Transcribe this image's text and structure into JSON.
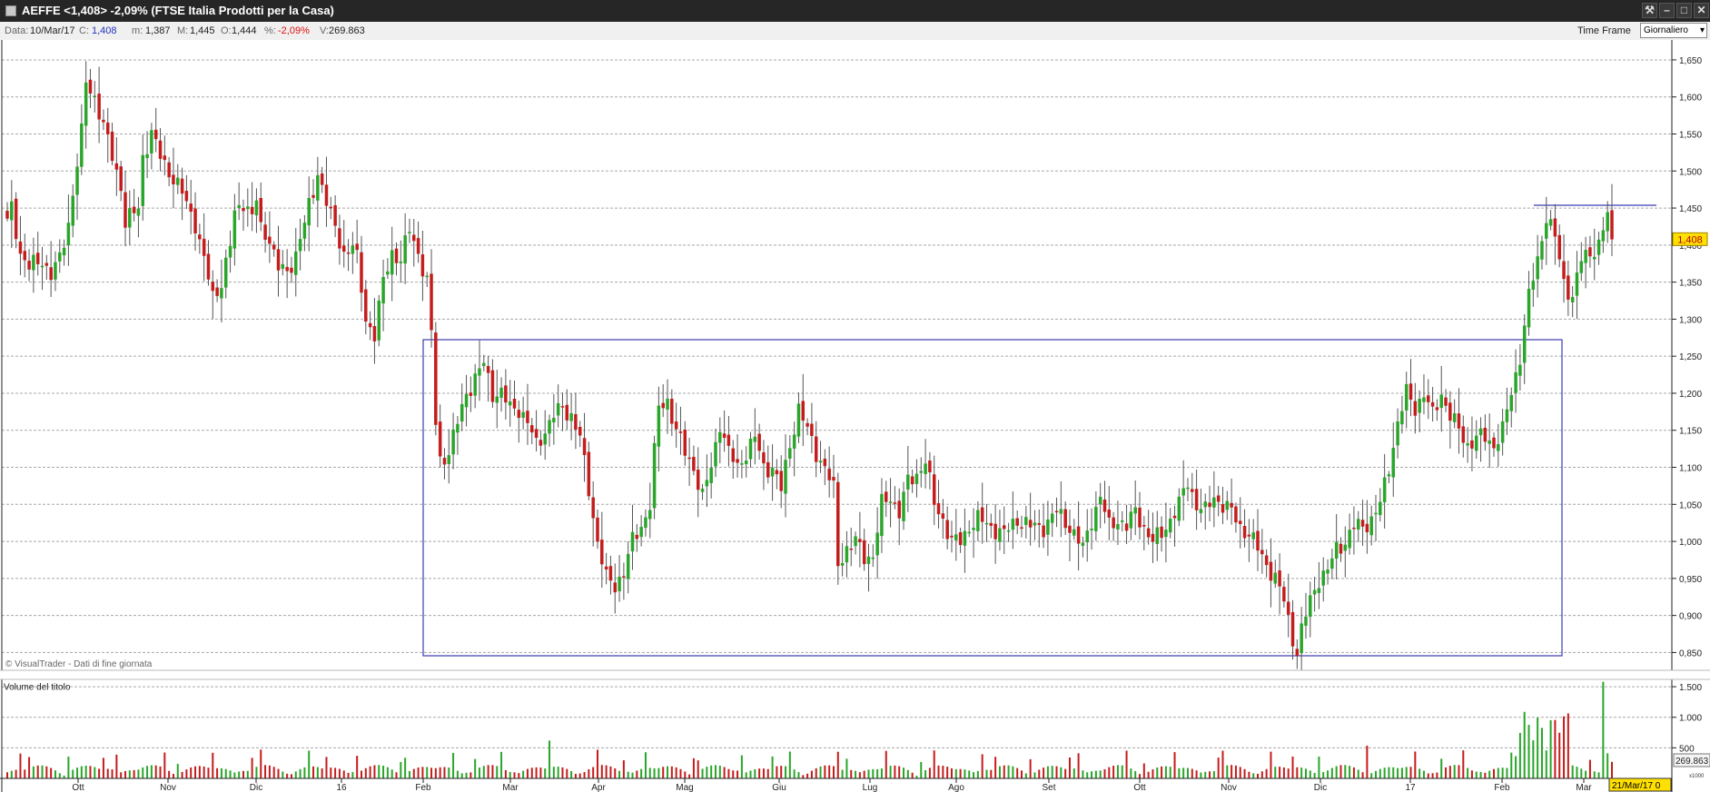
{
  "window": {
    "title": "AEFFE <1,408> -2,09%  (FTSE Italia Prodotti per la Casa)"
  },
  "infobar": {
    "date_label": "Data:",
    "date_value": "10/Mar/17",
    "close_label": "C:",
    "close_value": "1,408",
    "min_label": "m:",
    "min_value": "1,387",
    "max_label": "M:",
    "max_value": "1,445",
    "open_label": "O:",
    "open_value": "1,444",
    "pct_label": "%:",
    "pct_value": "-2,09%",
    "vol_label": "V:",
    "vol_value": "269.863",
    "timeframe_label": "Time Frame",
    "timeframe_value": "Giornaliero"
  },
  "chart_data": {
    "type": "candlestick",
    "price_axis": {
      "ticks": [
        "1,650",
        "1,600",
        "1,550",
        "1,500",
        "1,450",
        "1,400",
        "1,350",
        "1,300",
        "1,250",
        "1,200",
        "1,150",
        "1,100",
        "1,050",
        "1,000",
        "0,950",
        "0,900",
        "0,850"
      ],
      "range": [
        0.826,
        1.672
      ]
    },
    "last_price_label": "1,408",
    "last_price": 1.408,
    "watermark": "© VisualTrader - Dati di fine giornata",
    "volume_title": "Volume del titolo",
    "volume_axis": {
      "ticks": [
        "1.500",
        "1.000",
        "500"
      ],
      "range": [
        0,
        1620
      ],
      "unit_label": "x1000"
    },
    "last_volume_label": "269.863",
    "x_axis_labels": [
      "Ott",
      "Nov",
      "Dic",
      "16",
      "Feb",
      "Mar",
      "Apr",
      "Mag",
      "Giu",
      "Lug",
      "Ago",
      "Set",
      "Ott",
      "Nov",
      "Dic",
      "17",
      "Feb",
      "Mar"
    ],
    "cursor_date_label": "21/Mar/17 0",
    "anchors": [
      [
        0,
        1.43
      ],
      [
        1,
        1.45
      ],
      [
        3,
        1.39
      ],
      [
        5,
        1.37
      ],
      [
        8,
        1.38
      ],
      [
        10,
        1.36
      ],
      [
        12,
        1.38
      ],
      [
        14,
        1.43
      ],
      [
        17,
        1.55
      ],
      [
        18,
        1.62
      ],
      [
        20,
        1.6
      ],
      [
        22,
        1.56
      ],
      [
        24,
        1.52
      ],
      [
        26,
        1.48
      ],
      [
        27,
        1.43
      ],
      [
        30,
        1.45
      ],
      [
        31,
        1.52
      ],
      [
        33,
        1.55
      ],
      [
        35,
        1.52
      ],
      [
        37,
        1.5
      ],
      [
        40,
        1.47
      ],
      [
        43,
        1.43
      ],
      [
        45,
        1.38
      ],
      [
        47,
        1.33
      ],
      [
        49,
        1.35
      ],
      [
        51,
        1.4
      ],
      [
        52,
        1.44
      ],
      [
        54,
        1.46
      ],
      [
        56,
        1.44
      ],
      [
        57,
        1.46
      ],
      [
        58,
        1.42
      ],
      [
        60,
        1.41
      ],
      [
        62,
        1.37
      ],
      [
        64,
        1.36
      ],
      [
        66,
        1.39
      ],
      [
        68,
        1.43
      ],
      [
        70,
        1.47
      ],
      [
        71,
        1.5
      ],
      [
        73,
        1.46
      ],
      [
        75,
        1.42
      ],
      [
        77,
        1.39
      ],
      [
        79,
        1.4
      ],
      [
        80,
        1.38
      ],
      [
        82,
        1.3
      ],
      [
        84,
        1.28
      ],
      [
        86,
        1.35
      ],
      [
        88,
        1.39
      ],
      [
        90,
        1.38
      ],
      [
        92,
        1.42
      ],
      [
        94,
        1.39
      ],
      [
        96,
        1.35
      ],
      [
        97,
        1.28
      ],
      [
        98,
        1.16
      ],
      [
        99,
        1.11
      ],
      [
        101,
        1.12
      ],
      [
        103,
        1.16
      ],
      [
        105,
        1.2
      ],
      [
        107,
        1.22
      ],
      [
        109,
        1.24
      ],
      [
        111,
        1.2
      ],
      [
        113,
        1.2
      ],
      [
        115,
        1.18
      ],
      [
        117,
        1.18
      ],
      [
        119,
        1.16
      ],
      [
        121,
        1.13
      ],
      [
        123,
        1.15
      ],
      [
        125,
        1.17
      ],
      [
        127,
        1.18
      ],
      [
        129,
        1.17
      ],
      [
        131,
        1.14
      ],
      [
        133,
        1.07
      ],
      [
        135,
        1.0
      ],
      [
        137,
        0.95
      ],
      [
        139,
        0.94
      ],
      [
        141,
        0.96
      ],
      [
        143,
        1.0
      ],
      [
        145,
        1.02
      ],
      [
        147,
        1.05
      ],
      [
        148,
        1.12
      ],
      [
        149,
        1.18
      ],
      [
        151,
        1.19
      ],
      [
        153,
        1.15
      ],
      [
        155,
        1.12
      ],
      [
        157,
        1.1
      ],
      [
        159,
        1.06
      ],
      [
        161,
        1.1
      ],
      [
        163,
        1.16
      ],
      [
        165,
        1.12
      ],
      [
        167,
        1.1
      ],
      [
        169,
        1.12
      ],
      [
        171,
        1.14
      ],
      [
        173,
        1.1
      ],
      [
        175,
        1.1
      ],
      [
        177,
        1.07
      ],
      [
        179,
        1.13
      ],
      [
        181,
        1.18
      ],
      [
        183,
        1.15
      ],
      [
        185,
        1.12
      ],
      [
        187,
        1.1
      ],
      [
        189,
        1.07
      ],
      [
        190,
        0.97
      ],
      [
        192,
        0.99
      ],
      [
        194,
        1.0
      ],
      [
        196,
        0.98
      ],
      [
        198,
        0.98
      ],
      [
        200,
        1.05
      ],
      [
        202,
        1.06
      ],
      [
        204,
        1.04
      ],
      [
        206,
        1.08
      ],
      [
        208,
        1.09
      ],
      [
        210,
        1.11
      ],
      [
        212,
        1.05
      ],
      [
        214,
        1.03
      ],
      [
        216,
        1.0
      ],
      [
        218,
        1.0
      ],
      [
        220,
        1.02
      ],
      [
        222,
        1.03
      ],
      [
        225,
        1.02
      ],
      [
        228,
        1.01
      ],
      [
        231,
        1.03
      ],
      [
        234,
        1.02
      ],
      [
        237,
        1.02
      ],
      [
        240,
        1.04
      ],
      [
        243,
        1.02
      ],
      [
        246,
        0.99
      ],
      [
        248,
        1.03
      ],
      [
        250,
        1.06
      ],
      [
        252,
        1.02
      ],
      [
        254,
        1.03
      ],
      [
        256,
        1.02
      ],
      [
        258,
        1.04
      ],
      [
        260,
        1.02
      ],
      [
        262,
        1.0
      ],
      [
        264,
        1.01
      ],
      [
        266,
        1.03
      ],
      [
        268,
        1.05
      ],
      [
        270,
        1.08
      ],
      [
        272,
        1.05
      ],
      [
        274,
        1.04
      ],
      [
        276,
        1.06
      ],
      [
        278,
        1.05
      ],
      [
        280,
        1.04
      ],
      [
        282,
        1.02
      ],
      [
        284,
        1.01
      ],
      [
        286,
        0.99
      ],
      [
        288,
        0.97
      ],
      [
        290,
        0.95
      ],
      [
        292,
        0.92
      ],
      [
        294,
        0.87
      ],
      [
        295,
        0.85
      ],
      [
        296,
        0.88
      ],
      [
        298,
        0.92
      ],
      [
        300,
        0.95
      ],
      [
        302,
        0.96
      ],
      [
        304,
        0.99
      ],
      [
        306,
        1.0
      ],
      [
        308,
        1.02
      ],
      [
        310,
        1.02
      ],
      [
        312,
        1.03
      ],
      [
        314,
        1.05
      ],
      [
        316,
        1.1
      ],
      [
        318,
        1.16
      ],
      [
        320,
        1.2
      ],
      [
        322,
        1.18
      ],
      [
        324,
        1.2
      ],
      [
        326,
        1.17
      ],
      [
        328,
        1.2
      ],
      [
        330,
        1.17
      ],
      [
        332,
        1.15
      ],
      [
        334,
        1.13
      ],
      [
        336,
        1.14
      ],
      [
        338,
        1.14
      ],
      [
        340,
        1.13
      ],
      [
        342,
        1.15
      ],
      [
        344,
        1.2
      ],
      [
        346,
        1.25
      ],
      [
        348,
        1.33
      ],
      [
        350,
        1.38
      ],
      [
        352,
        1.44
      ],
      [
        354,
        1.41
      ],
      [
        356,
        1.35
      ],
      [
        358,
        1.33
      ],
      [
        360,
        1.38
      ],
      [
        362,
        1.39
      ],
      [
        364,
        1.4
      ],
      [
        366,
        1.44
      ],
      [
        367,
        1.408
      ]
    ]
  }
}
